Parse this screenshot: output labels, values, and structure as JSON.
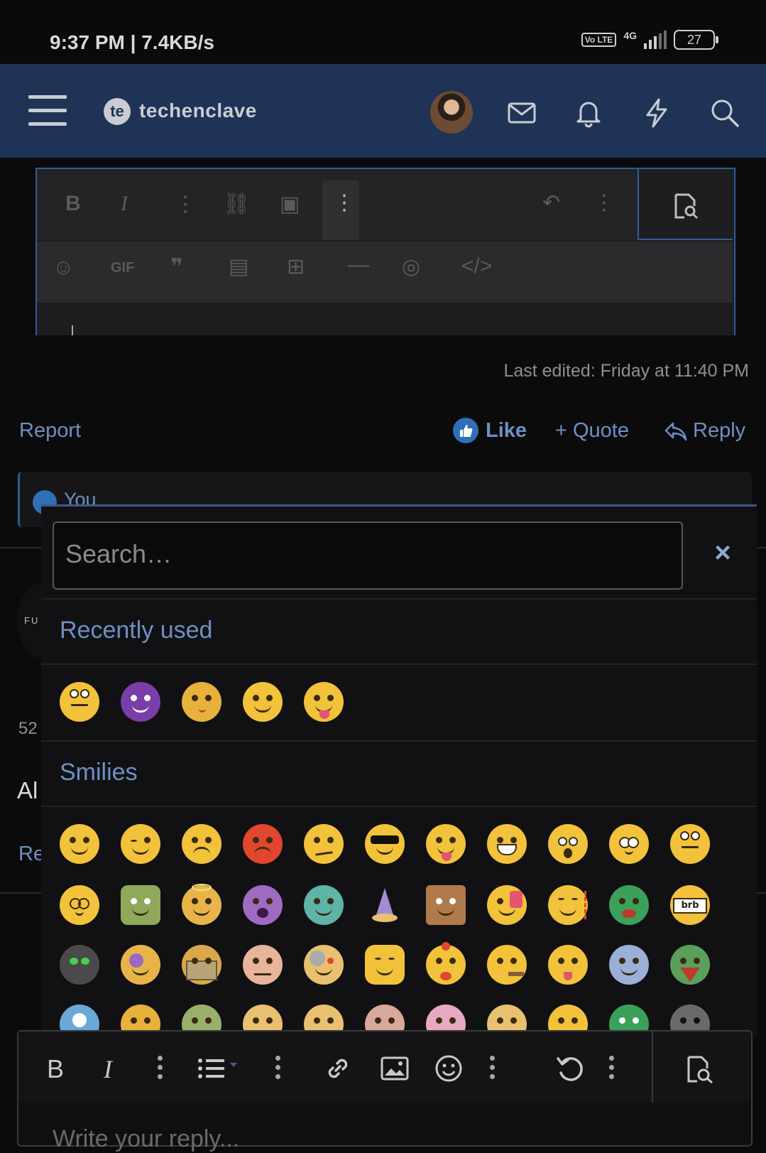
{
  "status_bar": {
    "time": "9:37 PM | 7.4KB/s",
    "network": "4G",
    "volte": "Vo LTE",
    "battery": "27"
  },
  "header": {
    "logo_badge": "te",
    "logo_text": "techenclave"
  },
  "post": {
    "last_edited": "Last edited: Friday at 11:40 PM",
    "report": "Report",
    "like": "Like",
    "quote": "+ Quote",
    "reply": "Reply",
    "likes_by": "You"
  },
  "background_post": {
    "avatar_text": "FU",
    "count_prefix": "52",
    "text_prefix": "Al",
    "reply_prefix": "Re"
  },
  "emoji_picker": {
    "search_placeholder": "Search…",
    "close": "×",
    "recently_used_title": "Recently used",
    "smilies_title": "Smilies"
  },
  "reply_editor": {
    "placeholder": "Write your reply..."
  }
}
